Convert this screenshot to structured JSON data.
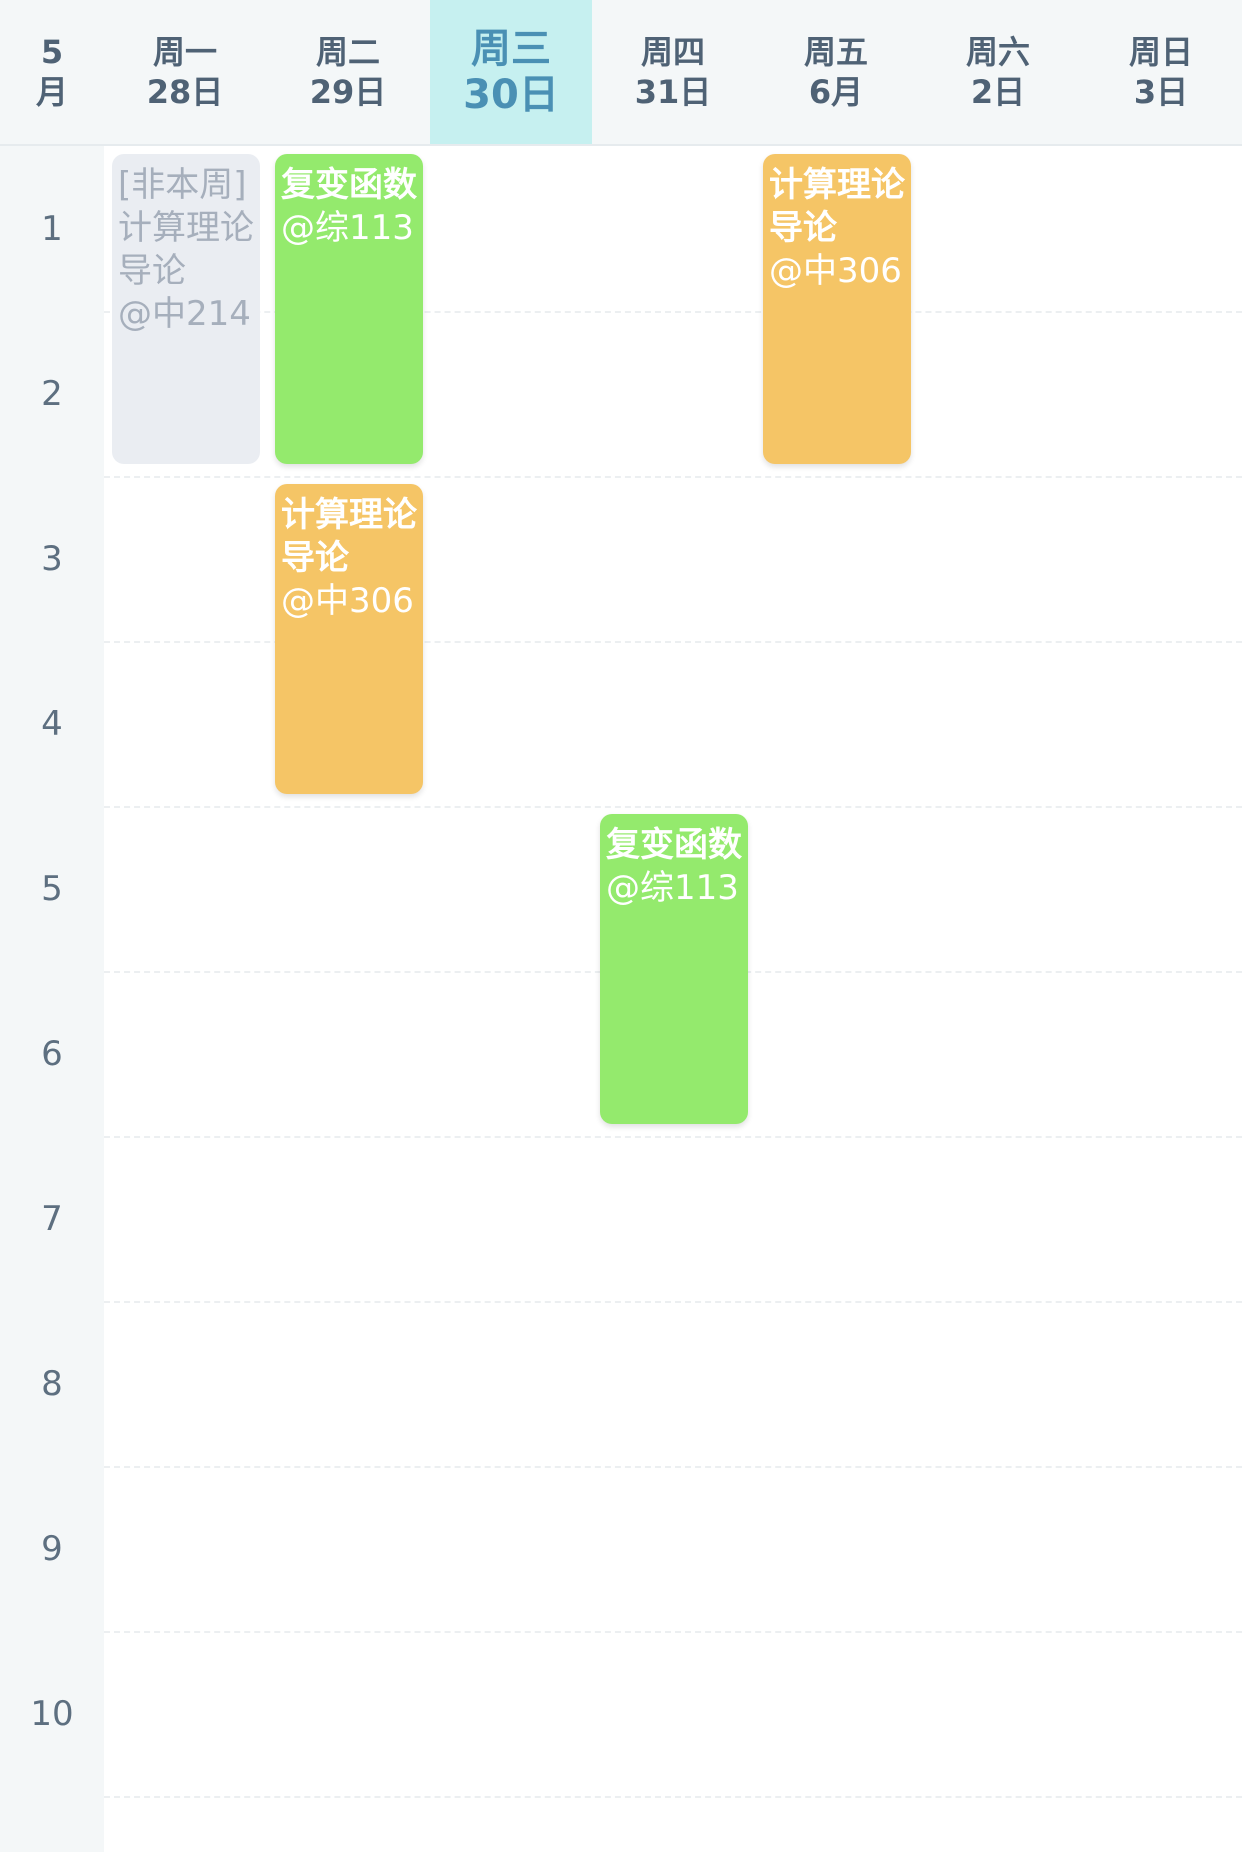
{
  "header": {
    "month": {
      "num": "5",
      "unit": "月"
    },
    "days": [
      {
        "weekday": "周一",
        "date": "28日"
      },
      {
        "weekday": "周二",
        "date": "29日"
      },
      {
        "weekday": "周三",
        "date": "30日"
      },
      {
        "weekday": "周四",
        "date": "31日"
      },
      {
        "weekday": "周五",
        "date": "6月"
      },
      {
        "weekday": "周六",
        "date": "2日"
      },
      {
        "weekday": "周日",
        "date": "3日"
      }
    ]
  },
  "periods": [
    "1",
    "2",
    "3",
    "4",
    "5",
    "6",
    "7",
    "8",
    "9",
    "10"
  ],
  "events": [
    {
      "tag": "[非本周]",
      "title": "计算理论导论",
      "room": "@中214",
      "day": "周一",
      "periods": "1-2",
      "status": "not-this-week"
    },
    {
      "title": "复变函数",
      "room": "@综113",
      "day": "周二",
      "periods": "1-2"
    },
    {
      "title": "计算理论导论",
      "room": "@中306",
      "day": "周二",
      "periods": "3-4"
    },
    {
      "title": "复变函数",
      "room": "@综113",
      "day": "周四",
      "periods": "5-6"
    },
    {
      "title": "计算理论导论",
      "room": "@中306",
      "day": "周五",
      "periods": "1-2"
    }
  ],
  "colors": {
    "course_green": "#94ea6d",
    "course_orange": "#f5c566",
    "inactive": "#eaedf2",
    "today_highlight": "#c6f0f0"
  }
}
